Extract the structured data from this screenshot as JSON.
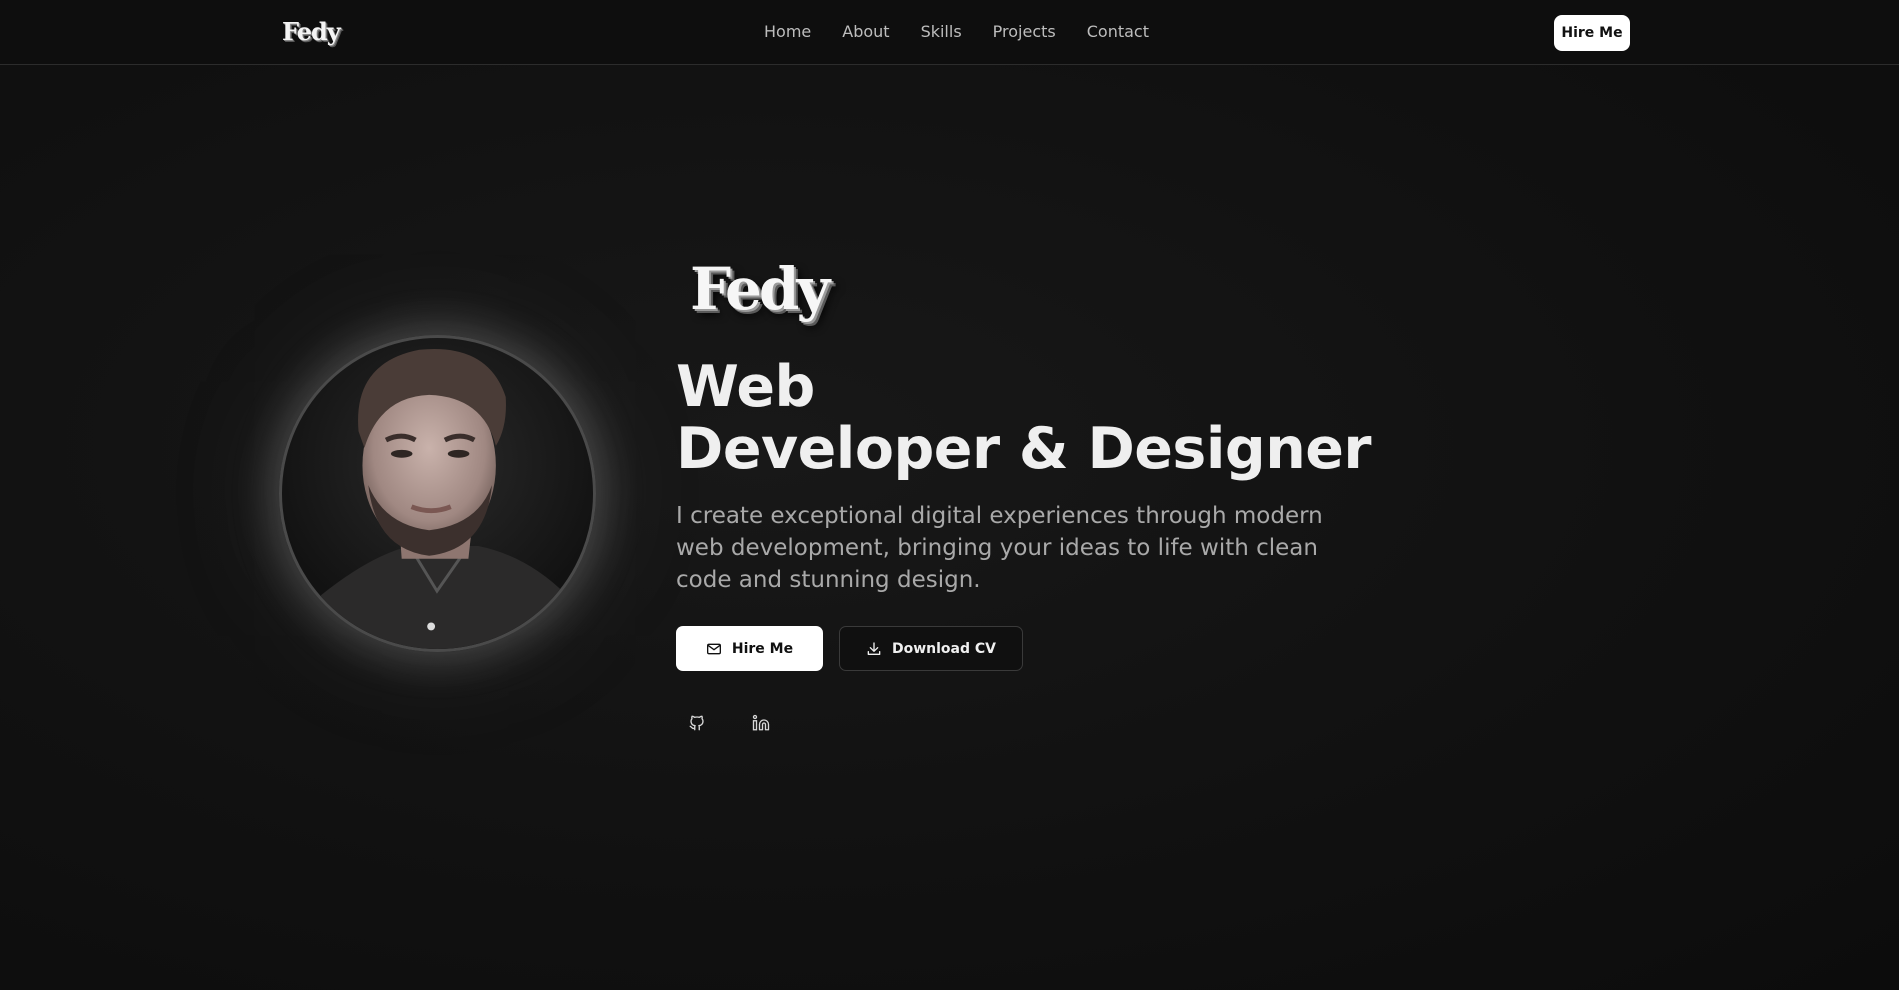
{
  "navbar": {
    "logo": "Fedy",
    "links": [
      {
        "label": "Home"
      },
      {
        "label": "About"
      },
      {
        "label": "Skills"
      },
      {
        "label": "Projects"
      },
      {
        "label": "Contact"
      }
    ],
    "cta_label": "Hire Me"
  },
  "hero": {
    "logo": "Fedy",
    "title_line1": "Web",
    "title_line2": "Developer & Designer",
    "description": "I create exceptional digital experiences through modern web development, bringing your ideas to life with clean code and stunning design.",
    "primary_button": {
      "label": "Hire Me",
      "icon": "mail-icon"
    },
    "secondary_button": {
      "label": "Download CV",
      "icon": "download-icon"
    },
    "socials": [
      {
        "icon": "github-icon"
      },
      {
        "icon": "linkedin-icon"
      }
    ]
  },
  "colors": {
    "background": "#0f0f0f",
    "text": "#ececec",
    "muted_text": "#a9a9a9",
    "button_light": "#ffffff"
  }
}
